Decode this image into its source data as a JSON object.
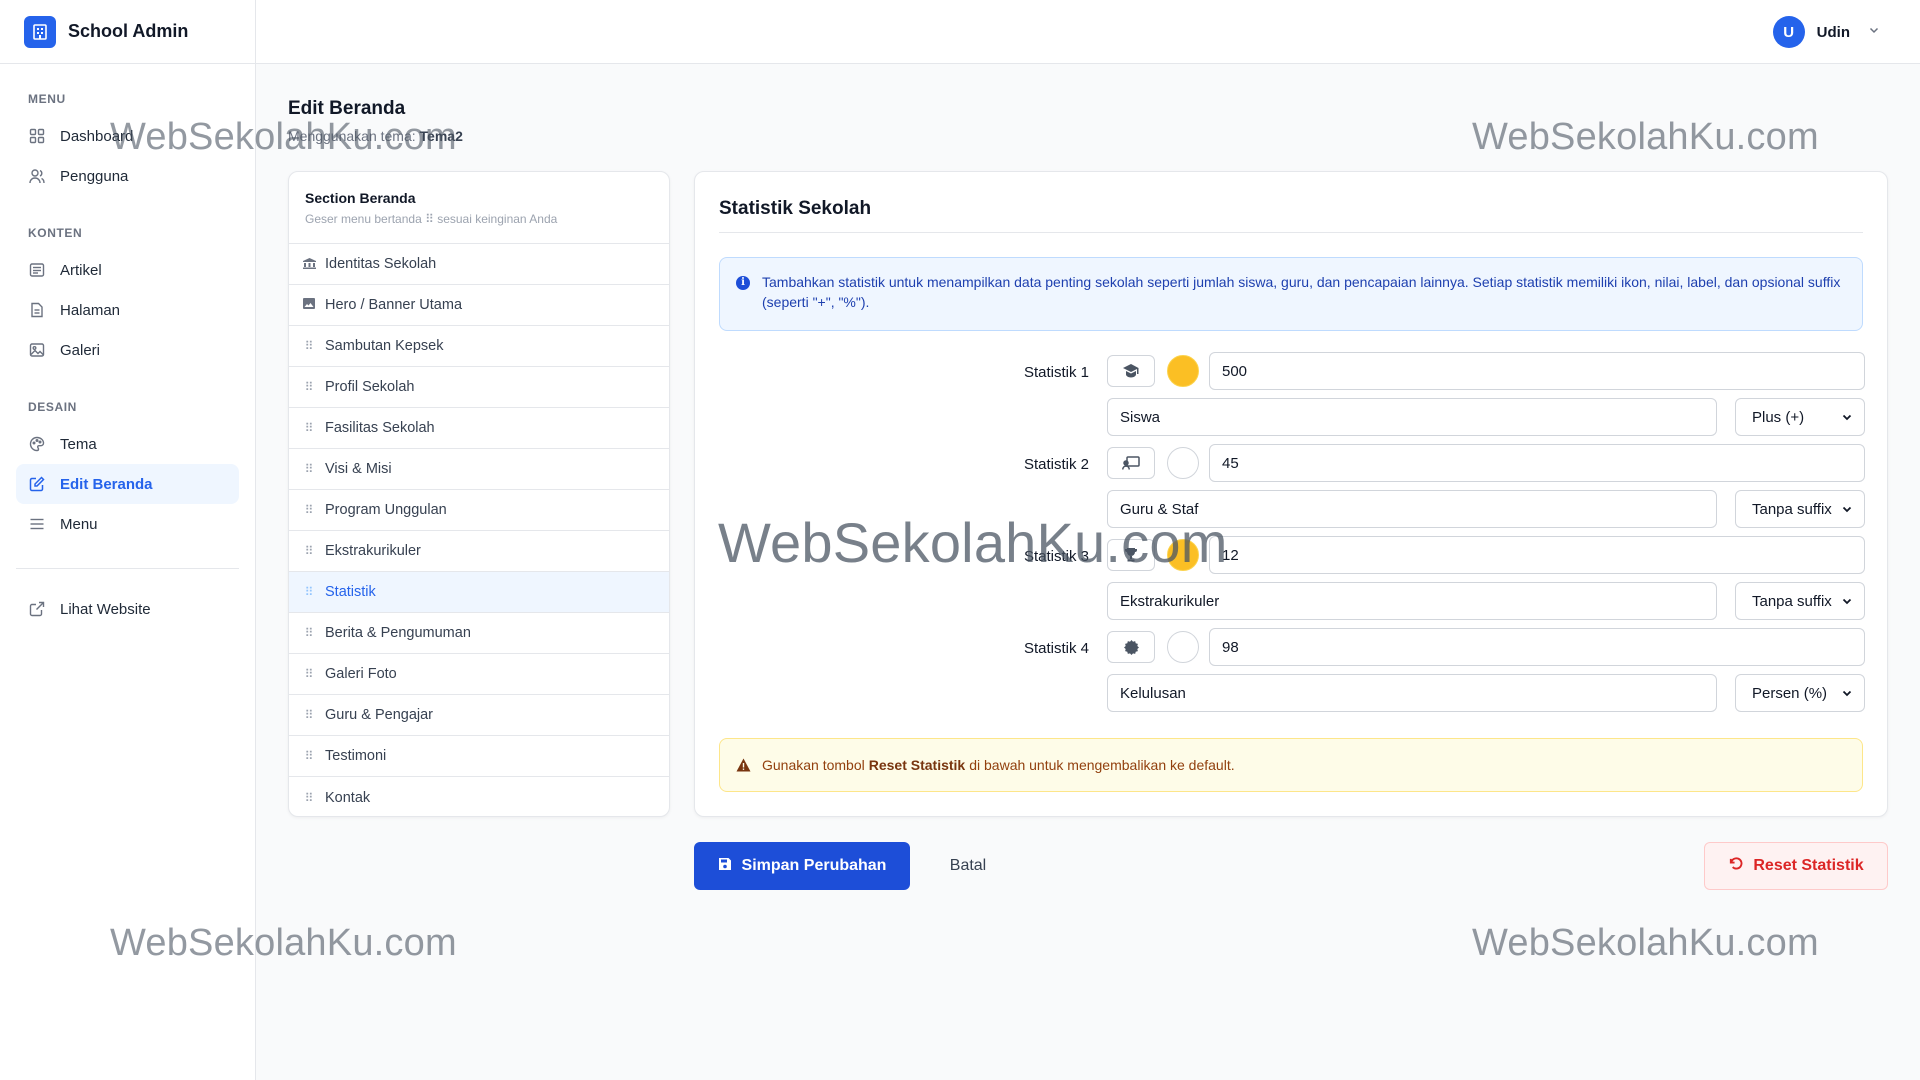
{
  "app": {
    "title": "School Admin"
  },
  "sidebar": {
    "groups": [
      {
        "heading": "MENU",
        "items": [
          {
            "label": "Dashboard",
            "icon": "grid-icon"
          },
          {
            "label": "Pengguna",
            "icon": "users-icon"
          }
        ]
      },
      {
        "heading": "KONTEN",
        "items": [
          {
            "label": "Artikel",
            "icon": "newspaper-icon"
          },
          {
            "label": "Halaman",
            "icon": "file-icon"
          },
          {
            "label": "Galeri",
            "icon": "image-icon"
          }
        ]
      },
      {
        "heading": "DESAIN",
        "items": [
          {
            "label": "Tema",
            "icon": "palette-icon"
          },
          {
            "label": "Edit Beranda",
            "icon": "edit-icon",
            "active": true
          },
          {
            "label": "Menu",
            "icon": "menu-icon"
          }
        ]
      }
    ],
    "external": {
      "label": "Lihat Website",
      "icon": "external-link-icon"
    }
  },
  "user": {
    "initial": "U",
    "name": "Udin"
  },
  "page": {
    "title": "Edit Beranda",
    "subtitle_prefix": "Menggunakan tema:",
    "theme": "Tema2"
  },
  "sections": {
    "title": "Section Beranda",
    "hint": "Geser menu bertanda ⠿ sesuai keinginan Anda",
    "items": [
      "Identitas Sekolah",
      "Hero / Banner Utama",
      "Sambutan Kepsek",
      "Profil Sekolah",
      "Fasilitas Sekolah",
      "Visi & Misi",
      "Program Unggulan",
      "Ekstrakurikuler",
      "Statistik",
      "Berita & Pengumuman",
      "Galeri Foto",
      "Guru & Pengajar",
      "Testimoni",
      "Kontak"
    ],
    "active": "Statistik"
  },
  "panel": {
    "title": "Statistik Sekolah",
    "info": "Tambahkan statistik untuk menampilkan data penting sekolah seperti jumlah siswa, guru, dan pencapaian lainnya. Setiap statistik memiliki ikon, nilai, label, dan opsional suffix (seperti \"+\", \"%\").",
    "stats": [
      {
        "label": "Statistik 1",
        "icon": "graduate-icon",
        "color": "#fbbf24",
        "value": "500",
        "name": "Siswa",
        "suffix": "Plus (+)"
      },
      {
        "label": "Statistik 2",
        "icon": "teacher-icon",
        "color": "#ffffff",
        "value": "45",
        "name": "Guru & Staf",
        "suffix": "Tanpa suffix"
      },
      {
        "label": "Statistik 3",
        "icon": "trophy-icon",
        "color": "#fbbf24",
        "value": "12",
        "name": "Ekstrakurikuler",
        "suffix": "Tanpa suffix"
      },
      {
        "label": "Statistik 4",
        "icon": "award-icon",
        "color": "#ffffff",
        "value": "98",
        "name": "Kelulusan",
        "suffix": "Persen (%)"
      }
    ],
    "warning_prefix": "Gunakan tombol",
    "warning_bold": "Reset Statistik",
    "warning_suffix": "di bawah untuk mengembalikan ke default."
  },
  "actions": {
    "save": "Simpan Perubahan",
    "cancel": "Batal",
    "reset": "Reset Statistik"
  },
  "watermark": "WebSekolahKu.com",
  "colors": {
    "primary": "#2563eb",
    "danger": "#dc2626",
    "info_bg": "#eff6ff",
    "warn_bg": "#fefce8",
    "accent_yellow": "#fbbf24"
  }
}
